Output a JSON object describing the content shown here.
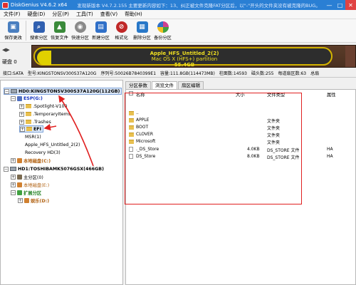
{
  "title_bar": {
    "title": "DiskGenius V4.6.2 x64",
    "notice": "发现新版本 V4.7.2.155 主要更新内容如下：13、纠正被文件克隆FAT分区后，以\"-\"开头的文件夹没有被克隆的BUG。",
    "minimize": "—",
    "maximize": "□",
    "close": "✕"
  },
  "menu": [
    "文件(F)",
    "硬盘(D)",
    "分区(P)",
    "工具(T)",
    "查看(V)",
    "帮助(H)"
  ],
  "toolbar": [
    {
      "label": "保存更改",
      "icon": "save-icon",
      "color": "#4a7fc0"
    },
    {
      "label": "搜索分区",
      "icon": "search-partition-icon",
      "color": "#3060b0"
    },
    {
      "label": "恢复文件",
      "icon": "recover-file-icon",
      "color": "#3a8a3a"
    },
    {
      "label": "快速分区",
      "icon": "quick-partition-icon",
      "color": "#8a8a8a"
    },
    {
      "label": "新建分区",
      "icon": "new-partition-icon",
      "color": "#3070c8"
    },
    {
      "label": "格式化",
      "icon": "format-icon",
      "color": "#c02828"
    },
    {
      "label": "删除分区",
      "icon": "delete-partition-icon",
      "color": "#2878c8"
    },
    {
      "label": "备份分区",
      "icon": "backup-partition-icon",
      "color": "#d04090"
    }
  ],
  "disk_bar": {
    "arrows": "◀▶",
    "disk_label": "硬盘 0",
    "partition_name": "Apple_HFS_Untitled_2(2)",
    "partition_fs": "Mac OS X (HFS+) partition",
    "partition_size": "55.4GB"
  },
  "info_line": {
    "interface": "接口:SATA",
    "model": "型号:KINGSTONSV300S37A120G",
    "serial": "序列号:50026B7840399E1",
    "capacity": "容量:111.8GB(114473MB)",
    "cylinders": "柱面数:14593",
    "heads": "磁头数:255",
    "sectors": "每道扇区数:63",
    "total": "总扇"
  },
  "tree": {
    "hd0": "HD0:KINGSTONSV300S37A120G(112GB)",
    "esp": "ESP(G:)",
    "spotlight": ".Spotlight-V100",
    "temporary": ".TemporaryItems",
    "trashes": ".Trashes",
    "efi": "EFI",
    "msr": "MSR(1)",
    "apple": "Apple_HFS_Untitled_2(2)",
    "recovery": "Recovery HD(3)",
    "local_c": "本地磁盘(C:)",
    "hd1": "HD1:TOSHIBAMK5076GSX(466GB)",
    "primary": "主分区(0)",
    "local_e": "本地磁盘(E:)",
    "extended": "扩展分区",
    "leisure": "娱乐(D:)"
  },
  "tabs": [
    "分区参数",
    "浏览文件",
    "扇区编辑"
  ],
  "file_list": {
    "headers": {
      "name": "名称",
      "size": "大小",
      "type": "文件类型",
      "attr": "属性"
    },
    "rows": [
      {
        "name": "..",
        "size": "",
        "type": "",
        "attr": "",
        "kind": "folder"
      },
      {
        "name": "APPLE",
        "size": "",
        "type": "文件夹",
        "attr": "",
        "kind": "folder"
      },
      {
        "name": "BOOT",
        "size": "",
        "type": "文件夹",
        "attr": "",
        "kind": "folder"
      },
      {
        "name": "CLOVER",
        "size": "",
        "type": "文件夹",
        "attr": "",
        "kind": "folder"
      },
      {
        "name": "Microsoft",
        "size": "",
        "type": "文件夹",
        "attr": "",
        "kind": "folder"
      },
      {
        "name": "._DS_Store",
        "size": "4.0KB",
        "type": "DS_STORE 文件",
        "attr": "HA",
        "kind": "file"
      },
      {
        "name": "DS_Store",
        "size": "8.0KB",
        "type": "DS_STORE 文件",
        "attr": "HA",
        "kind": "file"
      }
    ]
  },
  "colors": {
    "accent": "#2a7fd4",
    "highlight": "#e02020"
  }
}
